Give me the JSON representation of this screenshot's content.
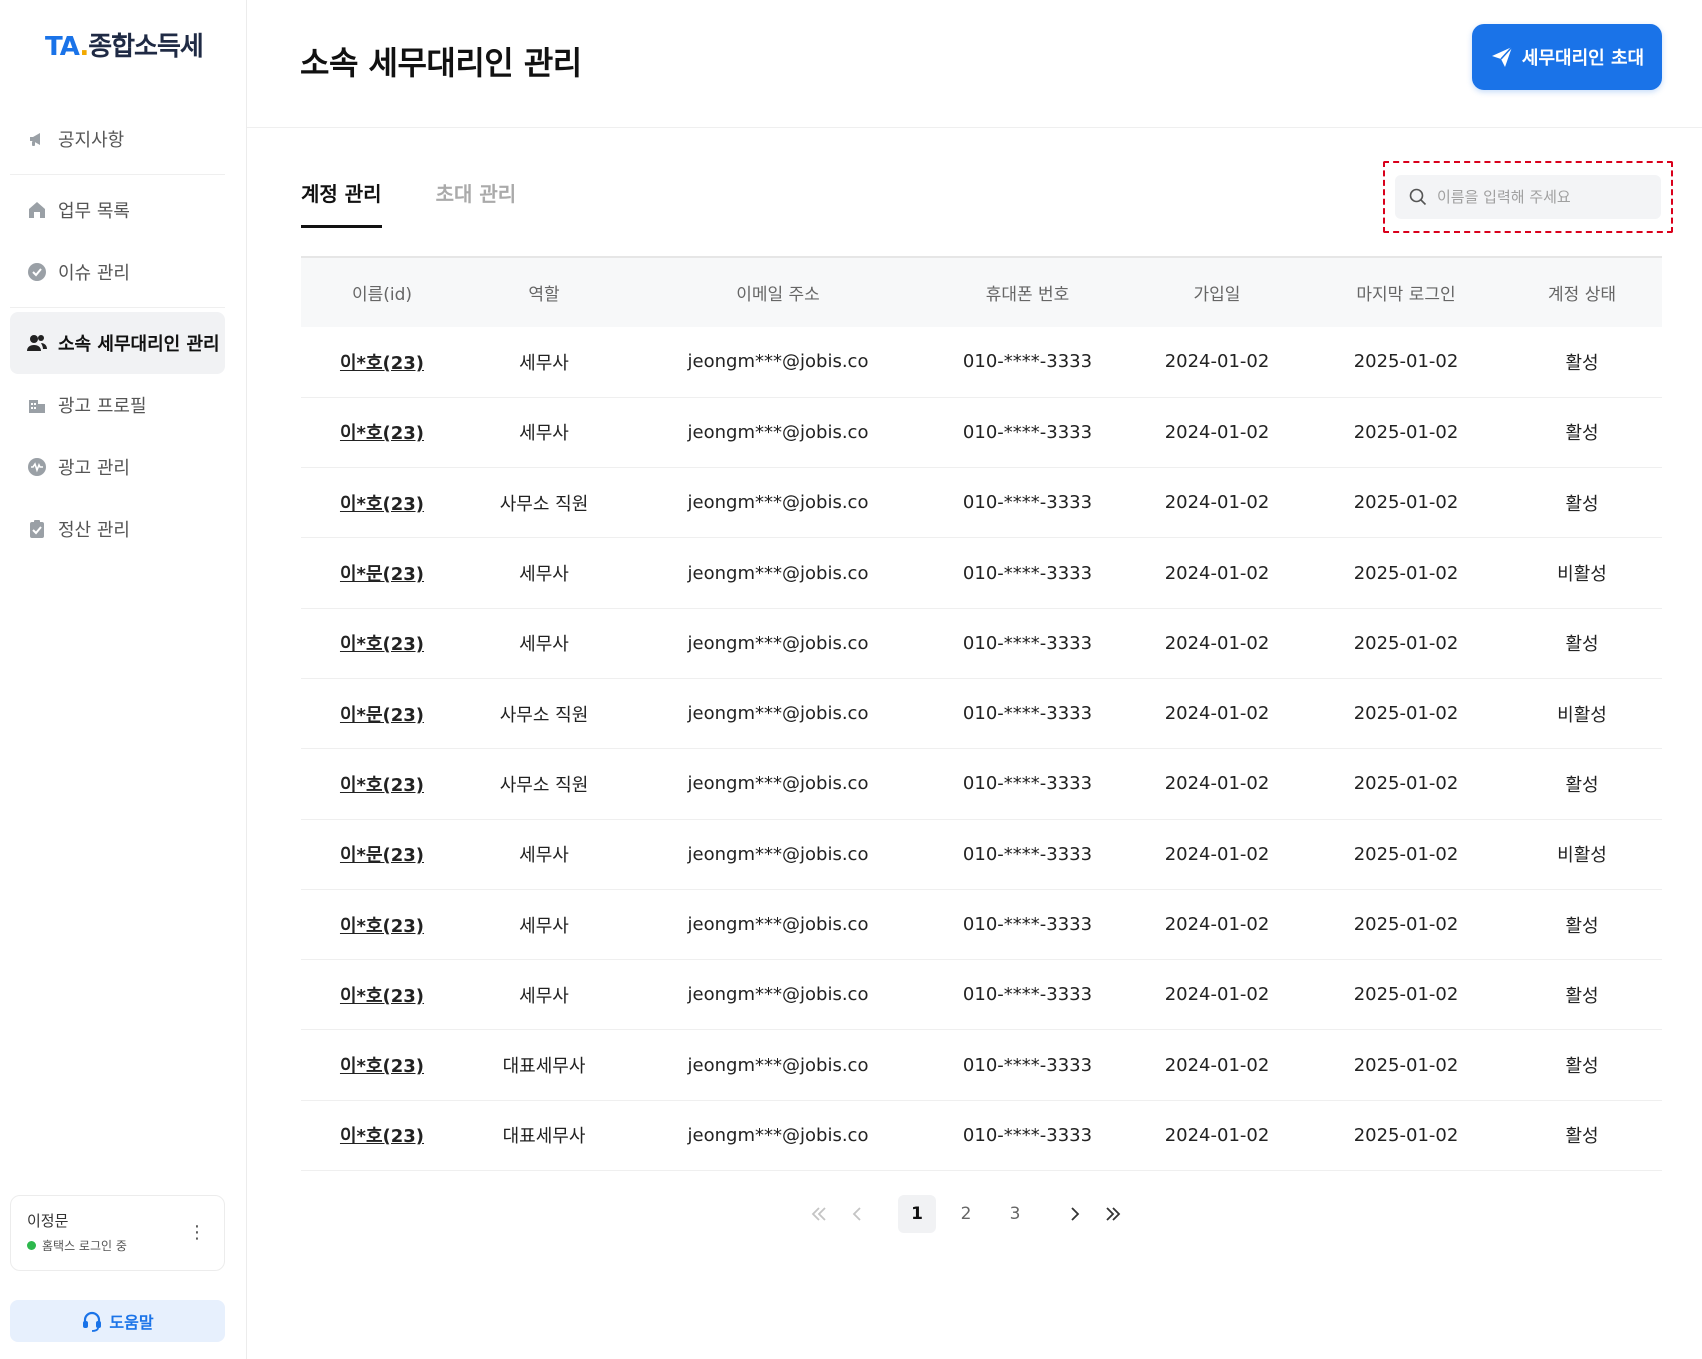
{
  "logo": {
    "ta": "TA",
    "dot": ".",
    "name": "종합소득세"
  },
  "nav": {
    "items": [
      {
        "label": "공지사항",
        "icon": "megaphone-icon"
      },
      {
        "label": "업무 목록",
        "icon": "home-icon"
      },
      {
        "label": "이슈 관리",
        "icon": "check-circle-icon"
      },
      {
        "label": "소속 세무대리인 관리",
        "icon": "users-icon",
        "active": true
      },
      {
        "label": "광고 프로필",
        "icon": "building-icon"
      },
      {
        "label": "광고 관리",
        "icon": "wave-circle-icon"
      },
      {
        "label": "정산 관리",
        "icon": "clipboard-check-icon"
      }
    ]
  },
  "user": {
    "name": "이정문",
    "status": "홈택스 로그인 중"
  },
  "help": {
    "label": "도움말"
  },
  "header": {
    "title": "소속 세무대리인 관리",
    "invite_label": "세무대리인 초대"
  },
  "tabs": [
    {
      "label": "계정 관리",
      "active": true
    },
    {
      "label": "초대 관리",
      "active": false
    }
  ],
  "search": {
    "placeholder": "이름을 입력해 주세요"
  },
  "table": {
    "columns": [
      "이름(id)",
      "역할",
      "이메일 주소",
      "휴대폰 번호",
      "가입일",
      "마지막 로그인",
      "계정 상태"
    ],
    "rows": [
      [
        "이*호(23)",
        "세무사",
        "jeongm***@jobis.co",
        "010-****-3333",
        "2024-01-02",
        "2025-01-02",
        "활성"
      ],
      [
        "이*호(23)",
        "세무사",
        "jeongm***@jobis.co",
        "010-****-3333",
        "2024-01-02",
        "2025-01-02",
        "활성"
      ],
      [
        "이*호(23)",
        "사무소 직원",
        "jeongm***@jobis.co",
        "010-****-3333",
        "2024-01-02",
        "2025-01-02",
        "활성"
      ],
      [
        "이*문(23)",
        "세무사",
        "jeongm***@jobis.co",
        "010-****-3333",
        "2024-01-02",
        "2025-01-02",
        "비활성"
      ],
      [
        "이*호(23)",
        "세무사",
        "jeongm***@jobis.co",
        "010-****-3333",
        "2024-01-02",
        "2025-01-02",
        "활성"
      ],
      [
        "이*문(23)",
        "사무소 직원",
        "jeongm***@jobis.co",
        "010-****-3333",
        "2024-01-02",
        "2025-01-02",
        "비활성"
      ],
      [
        "이*호(23)",
        "사무소 직원",
        "jeongm***@jobis.co",
        "010-****-3333",
        "2024-01-02",
        "2025-01-02",
        "활성"
      ],
      [
        "이*문(23)",
        "세무사",
        "jeongm***@jobis.co",
        "010-****-3333",
        "2024-01-02",
        "2025-01-02",
        "비활성"
      ],
      [
        "이*호(23)",
        "세무사",
        "jeongm***@jobis.co",
        "010-****-3333",
        "2024-01-02",
        "2025-01-02",
        "활성"
      ],
      [
        "이*호(23)",
        "세무사",
        "jeongm***@jobis.co",
        "010-****-3333",
        "2024-01-02",
        "2025-01-02",
        "활성"
      ],
      [
        "이*호(23)",
        "대표세무사",
        "jeongm***@jobis.co",
        "010-****-3333",
        "2024-01-02",
        "2025-01-02",
        "활성"
      ],
      [
        "이*호(23)",
        "대표세무사",
        "jeongm***@jobis.co",
        "010-****-3333",
        "2024-01-02",
        "2025-01-02",
        "활성"
      ]
    ]
  },
  "pagination": {
    "pages": [
      "1",
      "2",
      "3"
    ],
    "current": "1"
  },
  "colors": {
    "accent": "#1a73e8",
    "online": "#2db84d",
    "highlight_border": "#d9001b"
  }
}
